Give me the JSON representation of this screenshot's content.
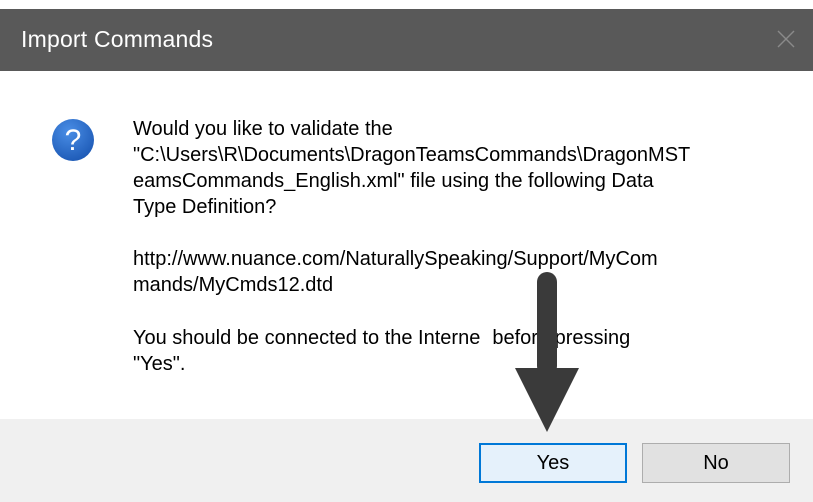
{
  "window": {
    "title": "Import Commands"
  },
  "dialog": {
    "message_lines": [
      "Would you like to validate the",
      "\"C:\\Users\\R\\Documents\\DragonTeamsCommands\\DragonMST",
      "eamsCommands_English.xml\" file using the following Data",
      "Type Definition?"
    ],
    "url_lines": [
      "http://www.nuance.com/NaturallySpeaking/Support/MyCom",
      "mands/MyCmds12.dtd"
    ],
    "note_lines": [
      "You should be connected to the Interne",
      "before pressing",
      "\"Yes\"."
    ]
  },
  "buttons": {
    "yes_label": "Yes",
    "no_label": "No"
  },
  "icons": {
    "question": "question-icon",
    "close": "close-icon",
    "annotation": "down-arrow-icon"
  },
  "colors": {
    "titlebar": "#595959",
    "icon_blue": "#2f6fcf",
    "footer": "#f0f0f0",
    "default_button_border": "#0078d7",
    "arrow": "#3a3a3a"
  }
}
